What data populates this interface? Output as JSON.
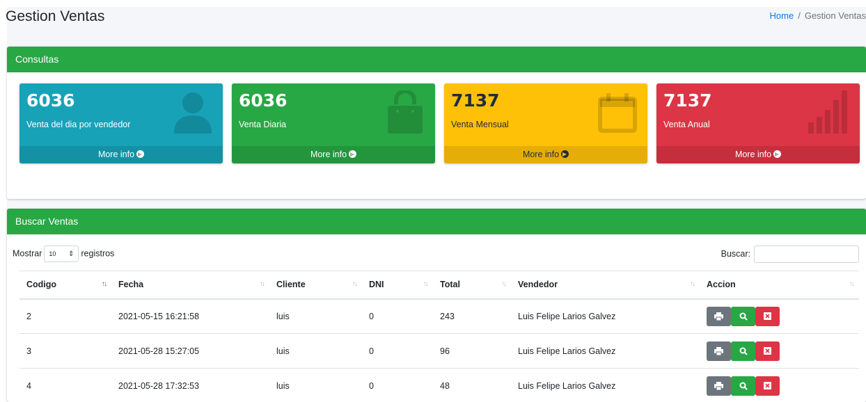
{
  "header": {
    "title": "Gestion Ventas",
    "breadcrumb_home": "Home",
    "breadcrumb_sep": "/",
    "breadcrumb_current": "Gestion Ventas"
  },
  "consultas": {
    "title": "Consultas",
    "boxes": [
      {
        "value": "6036",
        "label": "Venta del dia por vendedor",
        "footer": "More info",
        "icon": "user-icon",
        "color": "#17a2b8"
      },
      {
        "value": "6036",
        "label": "Venta Diaria",
        "footer": "More info",
        "icon": "shopping-bag-icon",
        "color": "#28a745"
      },
      {
        "value": "7137",
        "label": "Venta Mensual",
        "footer": "More info",
        "icon": "calendar-icon",
        "color": "#ffc107"
      },
      {
        "value": "7137",
        "label": "Venta Anual",
        "footer": "More info",
        "icon": "bar-chart-icon",
        "color": "#dc3545"
      }
    ]
  },
  "ventas": {
    "title": "Buscar Ventas",
    "length_prefix": "Mostrar",
    "length_value": "10",
    "length_suffix": "registros",
    "search_label": "Buscar:",
    "columns": [
      "Codigo",
      "Fecha",
      "Cliente",
      "DNI",
      "Total",
      "Vendedor",
      "Accion"
    ],
    "rows": [
      {
        "codigo": "2",
        "fecha": "2021-05-15 16:21:58",
        "cliente": "luis",
        "dni": "0",
        "total": "243",
        "vendedor": "Luis Felipe Larios Galvez"
      },
      {
        "codigo": "3",
        "fecha": "2021-05-28 15:27:05",
        "cliente": "luis",
        "dni": "0",
        "total": "96",
        "vendedor": "Luis Felipe Larios Galvez"
      },
      {
        "codigo": "4",
        "fecha": "2021-05-28 17:32:53",
        "cliente": "luis",
        "dni": "0",
        "total": "48",
        "vendedor": "Luis Felipe Larios Galvez"
      }
    ],
    "actions": [
      "print-icon",
      "search-icon",
      "delete-icon"
    ]
  },
  "colors": {
    "primary": "#007bff",
    "success": "#28a745",
    "info": "#17a2b8",
    "warning": "#ffc107",
    "danger": "#dc3545",
    "secondary": "#6c757d"
  }
}
